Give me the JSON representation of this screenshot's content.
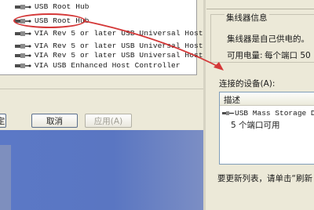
{
  "device_tree": {
    "items": [
      {
        "label": "USB Root Hub"
      },
      {
        "label": "USB Root Hub"
      },
      {
        "label": "VIA Rev 5 or later USB Universal Host"
      },
      {
        "label": "VIA Rev 5 or later USB Universal Host"
      },
      {
        "label": "VIA Rev 5 or later USB Universal Host"
      },
      {
        "label": "VIA USB Enhanced Host Controller"
      }
    ]
  },
  "buttons": {
    "ok_partial": "定",
    "cancel": "取消",
    "apply": "应用(A)"
  },
  "hub_info": {
    "group_title": "集线器信息",
    "self_powered": "集线器是自己供电的。",
    "power_label": "可用电量:",
    "power_value": "每个端口 50"
  },
  "connected_devices": {
    "label": "连接的设备(A):",
    "header": "描述",
    "device_name": "USB Mass Storage Dev",
    "ports_available": "5 个端口可用"
  },
  "refresh_hint": "要更新列表，请单击“刷新",
  "colors": {
    "annotation_red": "#d43838",
    "dialog_bg": "#ece9d8",
    "desktop_blue": "#5b78c6"
  }
}
